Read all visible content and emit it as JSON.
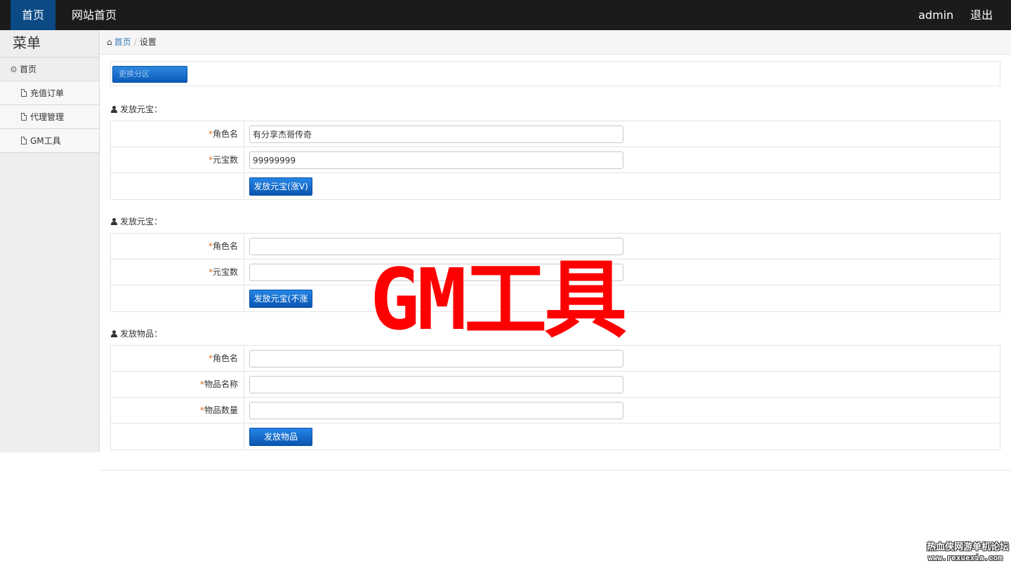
{
  "topnav": {
    "home": "首页",
    "site_home": "网站首页",
    "user": "admin",
    "logout": "退出"
  },
  "sidebar": {
    "title": "菜单",
    "group": "首页",
    "items": [
      {
        "label": "充值订单"
      },
      {
        "label": "代理管理"
      },
      {
        "label": "GM工具"
      }
    ]
  },
  "breadcrumb": {
    "home": "首页",
    "current": "设置"
  },
  "switch_server_label": "更换分区",
  "sections": [
    {
      "title": "发放元宝：",
      "fields": [
        {
          "label": "角色名",
          "value": "有分享杰哥传奇"
        },
        {
          "label": "元宝数",
          "value": "99999999"
        }
      ],
      "button": "发放元宝(涨V)"
    },
    {
      "title": "发放元宝：",
      "fields": [
        {
          "label": "角色名",
          "value": ""
        },
        {
          "label": "元宝数",
          "value": ""
        }
      ],
      "button": "发放元宝(不涨V)"
    },
    {
      "title": "发放物品：",
      "fields": [
        {
          "label": "角色名",
          "value": ""
        },
        {
          "label": "物品名称",
          "value": ""
        },
        {
          "label": "物品数量",
          "value": ""
        }
      ],
      "button": "发放物品"
    }
  ],
  "required_mark": "*",
  "overlay_text": "GM工具",
  "watermark": {
    "name": "热血侠网游单机论坛",
    "url": "www.rexuexia.com"
  },
  "colors": {
    "topbar": "#1b1b1b",
    "nav_active": "#0b4a85",
    "button": "#0a55b0",
    "overlay": "#ff0000",
    "required": "#e06c1a"
  }
}
